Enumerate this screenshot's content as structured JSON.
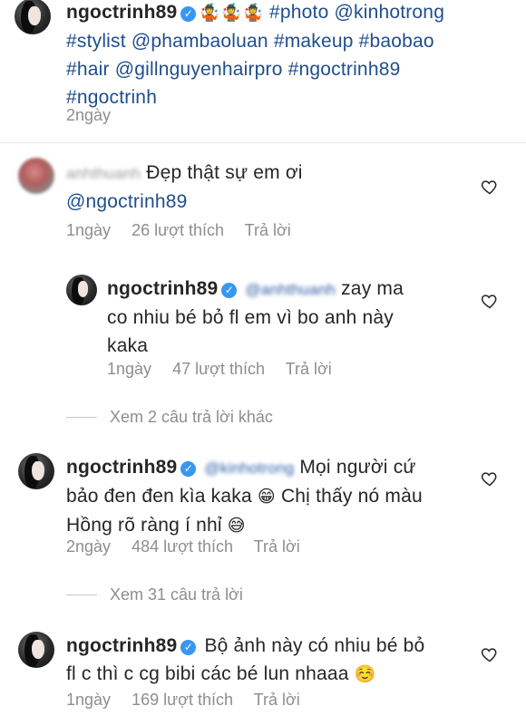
{
  "caption": {
    "username": "ngoctrinh89",
    "emojis": "🤹🤹🤹",
    "line1_tags": "#photo @kinhotrong",
    "line2": "#stylist @phambaoluan #makeup #baobao",
    "line3": "#hair @gillnguyenhairpro #ngoctrinh89",
    "line4": "#ngoctrinh",
    "time": "2ngày"
  },
  "comments": [
    {
      "username": "anhthuanh",
      "text_line1": "Đẹp thật sự em ơi",
      "text_line2": "@ngoctrinh89",
      "time": "1ngày",
      "likes": "26 lượt thích",
      "reply": "Trả lời"
    },
    {
      "username": "ngoctrinh89",
      "mention": "@anhthuanh",
      "text_line1": "zay ma",
      "text_line2": "co nhiu bé bỏ fl em vì bo anh này",
      "text_line3": "kaka",
      "time": "1ngày",
      "likes": "47 lượt thích",
      "reply": "Trả lời",
      "view_more": "Xem 2 câu trả lời khác"
    },
    {
      "username": "ngoctrinh89",
      "mention": "@kinhotrong",
      "text_line1": "Mọi người cứ",
      "text_line2a": "bảo đen đen kìa kaka",
      "emoji_a": "😁",
      "text_line2b": "Chị thấy nó màu",
      "text_line3": "Hồng rõ ràng í nhỉ",
      "emoji_b": "😅",
      "time": "2ngày",
      "likes": "484 lượt thích",
      "reply": "Trả lời",
      "view_more": "Xem 31 câu trả lời"
    },
    {
      "username": "ngoctrinh89",
      "text_line1": "Bộ ảnh này có nhiu bé bỏ",
      "text_line2": "fl c thì c cg bibi các bé lun nhaaa",
      "emoji": "☺️",
      "time": "1ngày",
      "likes": "169 lượt thích",
      "reply": "Trả lời"
    }
  ],
  "icons": {
    "verified": "verified-badge-icon",
    "heart": "heart-outline-icon"
  },
  "colors": {
    "tag_blue": "#1f4e8c",
    "meta_gray": "#8e8e8e",
    "verified_blue": "#3897f0"
  }
}
